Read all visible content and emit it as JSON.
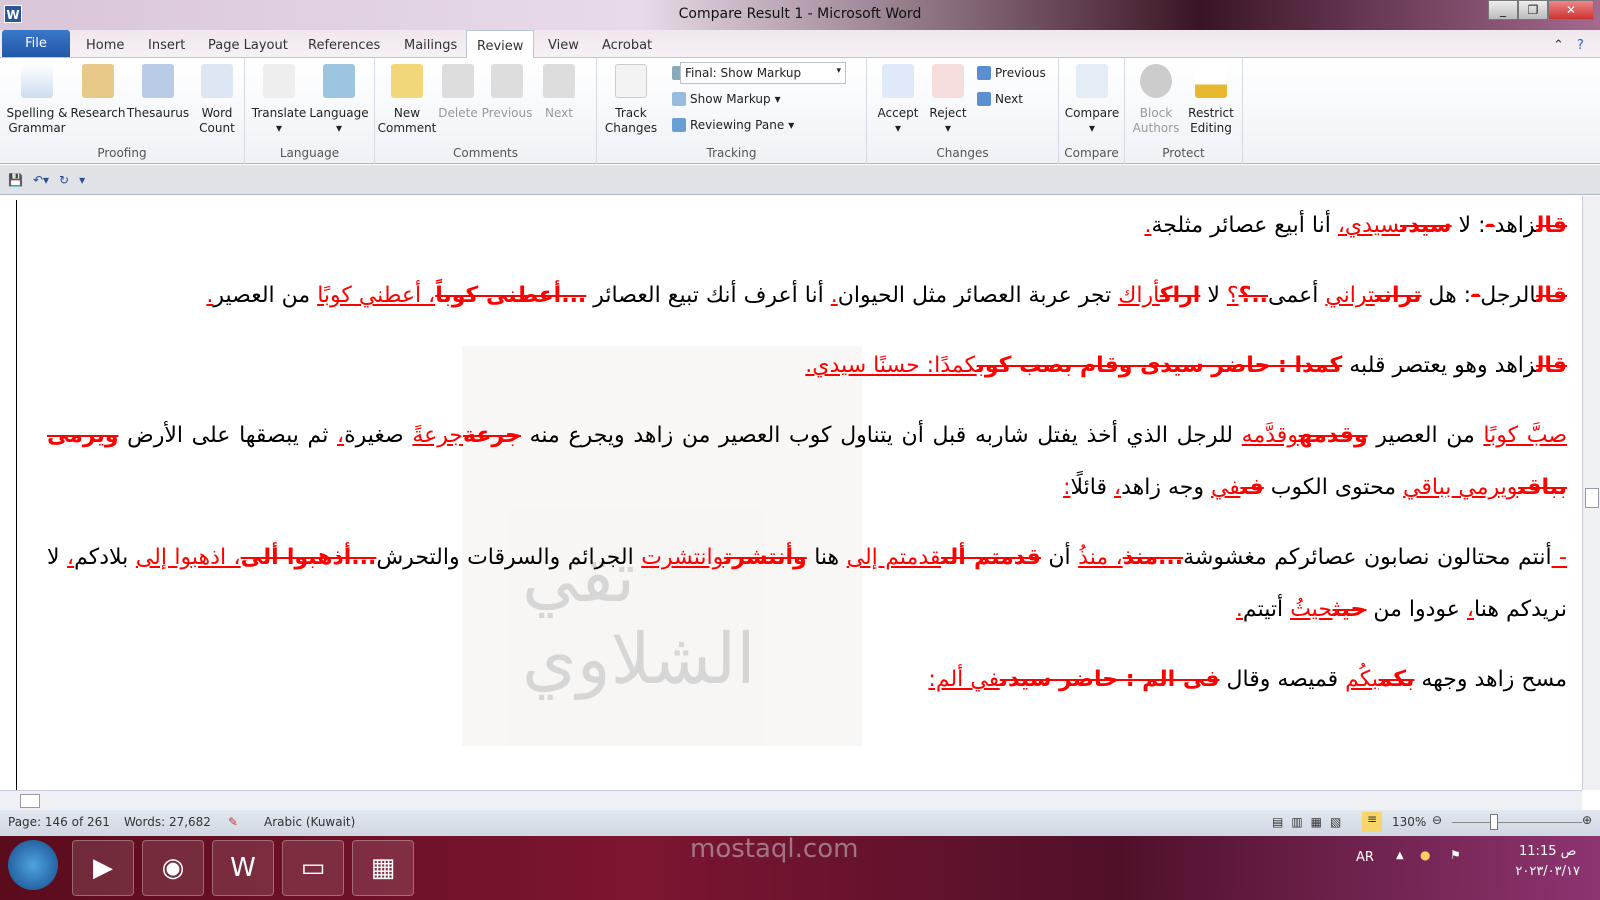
{
  "window": {
    "title": "Compare Result 1 - Microsoft Word",
    "app_icon": "W"
  },
  "tabs": [
    "File",
    "Home",
    "Insert",
    "Page Layout",
    "References",
    "Mailings",
    "Review",
    "View",
    "Acrobat"
  ],
  "active_tab": "Review",
  "ribbon": {
    "proofing": {
      "label": "Proofing",
      "spelling": "Spelling &",
      "spelling2": "Grammar",
      "research": "Research",
      "thesaurus": "Thesaurus",
      "wordcount": "Word",
      "wordcount2": "Count"
    },
    "language": {
      "label": "Language",
      "translate": "Translate",
      "language": "Language"
    },
    "comments": {
      "label": "Comments",
      "new": "New",
      "new2": "Comment",
      "delete": "Delete",
      "previous": "Previous",
      "next": "Next"
    },
    "tracking": {
      "label": "Tracking",
      "track": "Track",
      "track2": "Changes",
      "markup_select": "Final: Show Markup",
      "show_markup": "Show Markup",
      "reviewing_pane": "Reviewing Pane"
    },
    "changes": {
      "label": "Changes",
      "accept": "Accept",
      "reject": "Reject",
      "previous": "Previous",
      "next": "Next"
    },
    "compare": {
      "label": "Compare",
      "compare": "Compare"
    },
    "protect": {
      "label": "Protect",
      "block": "Block",
      "block2": "Authors",
      "restrict": "Restrict",
      "restrict2": "Editing"
    }
  },
  "document": {
    "paragraphs": [
      [
        [
          "d",
          "قال"
        ],
        [
          "n",
          "زاهد"
        ],
        [
          "d",
          "-"
        ],
        [
          "n",
          ": لا "
        ],
        [
          "d",
          "سيدى"
        ],
        [
          "i",
          "سيدي،"
        ],
        [
          "n",
          " أنا أبيع عصائر مثلجة"
        ],
        [
          "i",
          "."
        ]
      ],
      [
        [
          "d",
          "قال"
        ],
        [
          "n",
          "الرجل"
        ],
        [
          "d",
          "-"
        ],
        [
          "n",
          ": هل "
        ],
        [
          "d",
          "ترانى"
        ],
        [
          "i",
          "تراني"
        ],
        [
          "n",
          " أعمى"
        ],
        [
          "d",
          "..؟"
        ],
        [
          "i",
          "؟"
        ],
        [
          "n",
          " لا "
        ],
        [
          "d",
          "اراك"
        ],
        [
          "i",
          "أراك"
        ],
        [
          "n",
          " تجر عربة العصائر مثل الحيوان"
        ],
        [
          "i",
          "."
        ],
        [
          "n",
          " أنا أعرف أنك تبيع العصائر "
        ],
        [
          "d",
          "...أعطنى كوباً"
        ],
        [
          "i",
          "، أعطني كوبًا"
        ],
        [
          "n",
          " من العصير"
        ],
        [
          "i",
          "."
        ]
      ],
      [
        [
          "d",
          "قال"
        ],
        [
          "n",
          "زاهد وهو يعتصر قلبه "
        ],
        [
          "d",
          "كمدا : حاضر سيدى وقام بصب كوب"
        ],
        [
          "i",
          "كمدًا: حسنًا سيدي."
        ]
      ],
      [
        [
          "i",
          "صبَّ كوبًا"
        ],
        [
          "n",
          " من العصير "
        ],
        [
          "d",
          "وقدمه"
        ],
        [
          "i",
          "وقدَّمه"
        ],
        [
          "n",
          " للرجل الذي أخذ يفتل شاربه قبل أن يتناول كوب العصير من زاهد ويجرع منه "
        ],
        [
          "d",
          "جرعة"
        ],
        [
          "i",
          "جرعةً"
        ],
        [
          "n",
          " صغيرة"
        ],
        [
          "i",
          "،"
        ],
        [
          "n",
          " ثم يبصقها على الأرض "
        ],
        [
          "d",
          "ويرمى بباقى"
        ],
        [
          "i",
          "ويرمي بباقي"
        ],
        [
          "n",
          " محتوى الكوب "
        ],
        [
          "d",
          "فى"
        ],
        [
          "i",
          "في"
        ],
        [
          "n",
          " وجه زاهد"
        ],
        [
          "i",
          "،"
        ],
        [
          "n",
          " قائلًا"
        ],
        [
          "i",
          ":"
        ]
      ],
      [
        [
          "i",
          "- "
        ],
        [
          "n",
          "أنتم محتالون نصابون عصائركم مغشوشة"
        ],
        [
          "d",
          "...منذ"
        ],
        [
          "i",
          "، منذُ"
        ],
        [
          "n",
          " أن "
        ],
        [
          "d",
          "قدمتم ألى"
        ],
        [
          "i",
          "قدمتم إلى"
        ],
        [
          "n",
          " هنا "
        ],
        [
          "d",
          "وأنتشرت"
        ],
        [
          "i",
          "وانتشرت"
        ],
        [
          "n",
          " الجرائم والسرقات والتحرش"
        ],
        [
          "d",
          "...أذهبوا ألى"
        ],
        [
          "i",
          "، اذهبوا إلى"
        ],
        [
          "n",
          " بلادكم"
        ],
        [
          "i",
          "،"
        ],
        [
          "n",
          " لا نريدكم هنا"
        ],
        [
          "i",
          "،"
        ],
        [
          "n",
          " عودوا من "
        ],
        [
          "d",
          "حيث"
        ],
        [
          "i",
          "حيثُ"
        ],
        [
          "n",
          " أتيتم"
        ],
        [
          "i",
          "."
        ]
      ],
      [
        [
          "n",
          "مسح زاهد وجهه "
        ],
        [
          "d",
          "بكم"
        ],
        [
          "i",
          "بكُم"
        ],
        [
          "n",
          " قميصه وقال "
        ],
        [
          "d",
          "فى الم : حاضر سيدى"
        ],
        [
          "i",
          "في ألم:"
        ]
      ]
    ],
    "watermark_text": "تقي الشلاوي"
  },
  "status": {
    "page": "Page: 146 of 261",
    "words": "Words: 27,682",
    "language": "Arabic (Kuwait)",
    "zoom": "130%",
    "zoom_percent": 130
  },
  "taskbar": {
    "lang": "AR",
    "time": "11:15 ص",
    "date": "٢٠٢٣/٠٣/١٧"
  },
  "overlay_watermark": "mostaql.com",
  "colors": {
    "insert": "#ff0000",
    "delete": "#ff0000",
    "file_tab": "#2b64b8"
  }
}
